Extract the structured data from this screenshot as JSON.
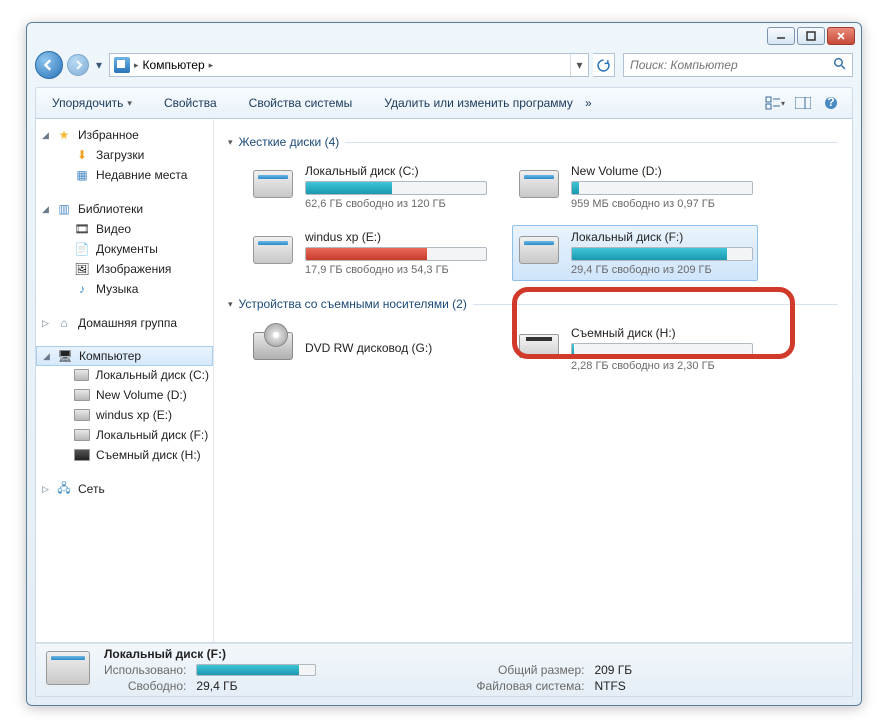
{
  "breadcrumb": {
    "root": "Компьютер"
  },
  "search": {
    "placeholder": "Поиск: Компьютер"
  },
  "toolbar": {
    "organize": "Упорядочить",
    "properties": "Свойства",
    "system_properties": "Свойства системы",
    "uninstall": "Удалить или изменить программу"
  },
  "sidebar": {
    "favorites": {
      "title": "Избранное",
      "items": [
        "Загрузки",
        "Недавние места"
      ]
    },
    "libraries": {
      "title": "Библиотеки",
      "items": [
        "Видео",
        "Документы",
        "Изображения",
        "Музыка"
      ]
    },
    "homegroup": "Домашняя группа",
    "computer": {
      "title": "Компьютер",
      "items": [
        "Локальный диск (C:)",
        "New Volume (D:)",
        "windus xp (E:)",
        "Локальный диск (F:)",
        "Съемный диск (H:)"
      ]
    },
    "network": "Сеть"
  },
  "groups": {
    "hdd": {
      "title": "Жесткие диски (4)"
    },
    "removable": {
      "title": "Устройства со съемными носителями (2)"
    }
  },
  "drives": {
    "c": {
      "name": "Локальный диск (C:)",
      "free": "62,6 ГБ свободно из 120 ГБ",
      "pct": 48
    },
    "d": {
      "name": "New Volume (D:)",
      "free": "959 МБ свободно из 0,97 ГБ",
      "pct": 4
    },
    "e": {
      "name": "windus xp (E:)",
      "free": "17,9 ГБ свободно из 54,3 ГБ",
      "pct": 67
    },
    "f": {
      "name": "Локальный диск (F:)",
      "free": "29,4 ГБ свободно из 209 ГБ",
      "pct": 86
    },
    "g": {
      "name": "DVD RW дисковод (G:)"
    },
    "h": {
      "name": "Съемный диск (H:)",
      "free": "2,28 ГБ свободно из 2,30 ГБ",
      "pct": 1
    }
  },
  "status": {
    "name": "Локальный диск (F:)",
    "used_label": "Использовано:",
    "free_label": "Свободно:",
    "free_val": "29,4 ГБ",
    "total_label": "Общий размер:",
    "total_val": "209 ГБ",
    "fs_label": "Файловая система:",
    "fs_val": "NTFS"
  }
}
